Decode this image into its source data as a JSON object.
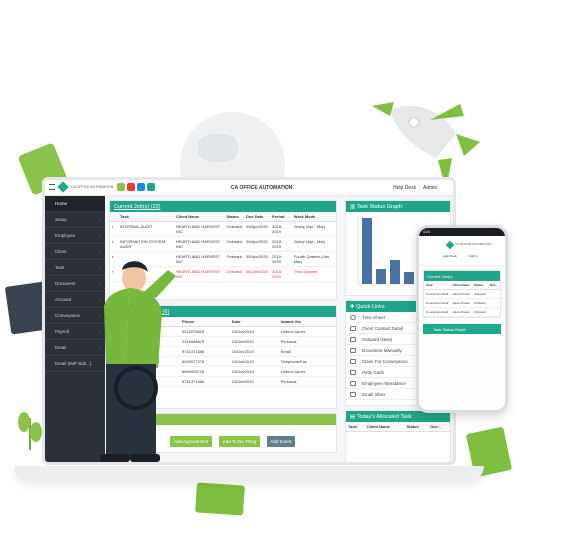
{
  "app": {
    "title": "CA OFFICE AUTOMATION",
    "brand": "CA OFFICE AUTOMATION",
    "user": "Help Desk",
    "admin": "Admin"
  },
  "sidebar": {
    "items": [
      {
        "label": "Home",
        "active": true
      },
      {
        "label": "Setup"
      },
      {
        "label": "Employee"
      },
      {
        "label": "Client"
      },
      {
        "label": "Task"
      },
      {
        "label": "Document"
      },
      {
        "label": "Account"
      },
      {
        "label": "Conveyance"
      },
      {
        "label": "Payroll"
      },
      {
        "label": "Email"
      },
      {
        "label": "Email (IMP Sub...)"
      }
    ]
  },
  "current_jobs": {
    "title": "Current Job(s) (22)",
    "columns": [
      "Task",
      "Client Name",
      "Status",
      "Due Date",
      "Period",
      "Work Mode"
    ],
    "rows": [
      [
        "INTERNAL AUDIT",
        "HEARTLAND HARVEST INC",
        "Onboard",
        "30/Apr/2020",
        "2018-2019",
        "Yearly (Apr - Mar)"
      ],
      [
        "INFORMATION SYSTEM AUDIT",
        "HEARTLAND HARVEST INC",
        "Onboard",
        "30/Apr/2020",
        "2018-2019",
        "Yearly (Apr - Mar)"
      ],
      [
        "",
        "HEARTLAND HARVEST INC",
        "Onboard",
        "30/Apr/2020",
        "2019-2020",
        "Fourth Quarter (Jan - Mar)"
      ],
      [
        "",
        "HEARTLAND HARVEST INC",
        "Onboard",
        "06/Jan/2020",
        "2019-2020",
        "Third Quarter"
      ]
    ]
  },
  "second_table": {
    "title": "...(s) (6)",
    "columns": [
      "Phone",
      "Date",
      "Inward Via"
    ],
    "rows": [
      [
        "...ancer society",
        "9013076629",
        "10/Oct/2019",
        "Letter/Courier"
      ],
      [
        "...VINEYARD & WINERY",
        "2316548675",
        "10/Oct/2019",
        "Personal"
      ],
      [
        "...BROTHERS",
        "9741371666",
        "10/Oct/2019",
        "Email"
      ],
      [
        "...LL STREET ANALYTICS",
        "6549977278",
        "10/Oct/2019",
        "Telephone/Fax"
      ],
      [
        "...INC",
        "6659926718",
        "10/Oct/2019",
        "Letter/Courier"
      ],
      [
        "...HARVEST INC",
        "9741371666",
        "10/Oct/2019",
        "Personal"
      ]
    ]
  },
  "task_status_graph": {
    "title": "Task Status Graph",
    "chart_data": {
      "type": "bar",
      "values": [
        22,
        5,
        8,
        4,
        8,
        2
      ]
    }
  },
  "quick_links": {
    "title": "Quick Links",
    "items": [
      "Time Sheet",
      "Client Contact Detail",
      "Outward (New)",
      "Document Manually",
      "Claim For Conveyance",
      "Petty Cash",
      "Employee Attendance",
      "Email Inbox"
    ]
  },
  "actions": {
    "add_appointment": "Add Appointment",
    "add_todo": "Add To Do Thing",
    "add_event": "Add Event"
  },
  "allocated_task": {
    "title": "Today's Allocated Task",
    "columns": [
      "Task",
      "Client Name",
      "Status",
      "Due..."
    ]
  },
  "phone": {
    "status_time": "4:24",
    "brand": "CA OFFICE AUTOMATION",
    "user": "Help Desk",
    "admin": "Admin",
    "section": "Current Job(s)",
    "columns": [
      "Task",
      "Client Name",
      "Status",
      "Due..."
    ],
    "rows": [
      [
        "Concurrent Audit",
        "Adam Power",
        "Onboard"
      ],
      [
        "Concurrent Audit",
        "Adam Power",
        "Onboard"
      ],
      [
        "Concurrent Audit",
        "Adam Power",
        "Onboard"
      ]
    ],
    "graph_button": "Task Status Graph"
  },
  "colors": {
    "accent": "#1fa58a",
    "green": "#8bc34a",
    "sidebar": "#2b3039",
    "bar": "#4a6fa5"
  }
}
